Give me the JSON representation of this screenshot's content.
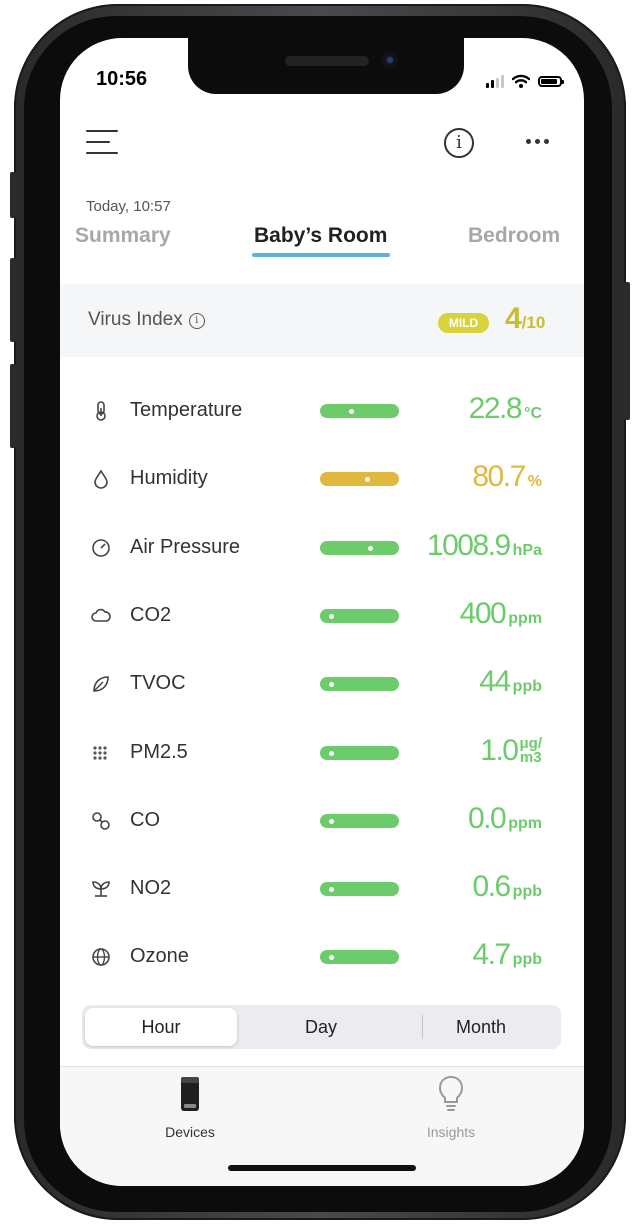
{
  "status_bar": {
    "time": "10:56"
  },
  "header": {
    "date": "Today, 10:57"
  },
  "tabs": [
    {
      "label": "Summary",
      "active": false
    },
    {
      "label": "Baby’s Room",
      "active": true
    },
    {
      "label": "Bedroom",
      "active": false
    }
  ],
  "virus_index": {
    "label": "Virus Index",
    "info_glyph": "i",
    "level": "MILD",
    "score": "4",
    "max": "/10"
  },
  "metrics": [
    {
      "name": "Temperature",
      "value": "22.8",
      "unit": "°C",
      "level": 0.38,
      "status_color": "#6ccb6a",
      "icon": "thermometer-icon"
    },
    {
      "name": "Humidity",
      "value": "80.7",
      "unit": "%",
      "level": 0.62,
      "status_color": "#e0b83f",
      "icon": "droplet-icon"
    },
    {
      "name": "Air Pressure",
      "value": "1008.9",
      "unit": "hPa",
      "level": 0.66,
      "status_color": "#6ccb6a",
      "icon": "gauge-icon"
    },
    {
      "name": "CO2",
      "value": "400",
      "unit": "ppm",
      "level": 0.08,
      "status_color": "#6ccb6a",
      "icon": "cloud-icon"
    },
    {
      "name": "TVOC",
      "value": "44",
      "unit": "ppb",
      "level": 0.08,
      "status_color": "#6ccb6a",
      "icon": "leaf-icon"
    },
    {
      "name": "PM2.5",
      "value": "1.0",
      "unit_top": "μg/",
      "unit_bottom": "m3",
      "level": 0.08,
      "status_color": "#6ccb6a",
      "icon": "particles-icon"
    },
    {
      "name": "CO",
      "value": "0.0",
      "unit": "ppm",
      "level": 0.08,
      "status_color": "#6ccb6a",
      "icon": "molecule-icon"
    },
    {
      "name": "NO2",
      "value": "0.6",
      "unit": "ppb",
      "level": 0.08,
      "status_color": "#6ccb6a",
      "icon": "sprout-icon"
    },
    {
      "name": "Ozone",
      "value": "4.7",
      "unit": "ppb",
      "level": 0.08,
      "status_color": "#6ccb6a",
      "icon": "globe-icon"
    }
  ],
  "time_range": {
    "options": [
      "Hour",
      "Day",
      "Month"
    ],
    "selected": "Hour"
  },
  "tab_bar": [
    {
      "label": "Devices",
      "active": true,
      "icon": "purifier-device-icon"
    },
    {
      "label": "Insights",
      "active": false,
      "icon": "lightbulb-icon"
    }
  ],
  "colors": {
    "accent_underline": "#5fb1d7",
    "good": "#6ccb6a",
    "moderate": "#e0b83f",
    "mild_badge": "#d8d23c"
  }
}
